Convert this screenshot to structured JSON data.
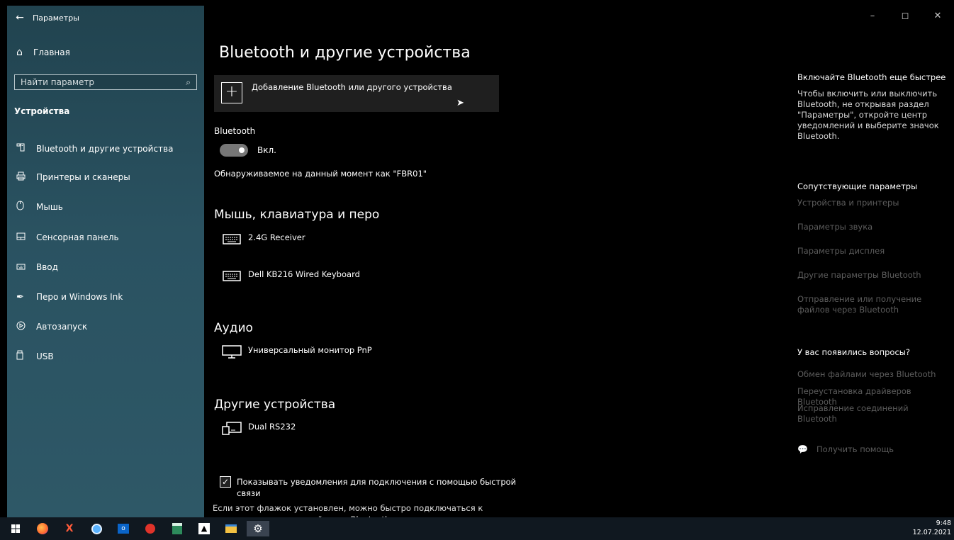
{
  "window": {
    "title": "Параметры",
    "back_icon": "←"
  },
  "controls": {
    "minimize": "–",
    "maximize": "◻",
    "close": "✕"
  },
  "sidebar": {
    "home_label": "Главная",
    "search_placeholder": "Найти параметр",
    "section": "Устройства",
    "items": [
      {
        "label": "Bluetooth и другие устройства",
        "icon": "bluetooth-devices-icon"
      },
      {
        "label": "Принтеры и сканеры",
        "icon": "printer-icon"
      },
      {
        "label": "Мышь",
        "icon": "mouse-icon"
      },
      {
        "label": "Сенсорная панель",
        "icon": "touchpad-icon"
      },
      {
        "label": "Ввод",
        "icon": "keyboard-icon"
      },
      {
        "label": "Перо и Windows Ink",
        "icon": "pen-icon"
      },
      {
        "label": "Автозапуск",
        "icon": "autoplay-icon"
      },
      {
        "label": "USB",
        "icon": "usb-icon"
      }
    ]
  },
  "main": {
    "title": "Bluetooth и другие устройства",
    "add_device": "Добавление Bluetooth или другого устройства",
    "bluetooth_label": "Bluetooth",
    "bluetooth_state": "Вкл.",
    "discoverable": "Обнаруживаемое на данный момент как \"FBR01\"",
    "mouse_section": "Мышь, клавиатура и перо",
    "mouse_devices": [
      "2.4G Receiver",
      "Dell KB216 Wired Keyboard"
    ],
    "audio_section": "Аудио",
    "audio_devices": [
      "Универсальный монитор PnP"
    ],
    "other_section": "Другие устройства",
    "other_devices": [
      "Dual RS232"
    ],
    "notify_checkbox": "Показывать уведомления для подключения с помощью быстрой связи",
    "notify_desc": "Если этот флажок установлен, можно быстро подключаться к поддерживаемым устройствам Bluetooth, когда они находятся"
  },
  "right": {
    "tip_title": "Включайте Bluetooth еще быстрее",
    "tip_text": "Чтобы включить или выключить Bluetooth, не открывая раздел \"Параметры\", откройте центр уведомлений и выберите значок Bluetooth.",
    "related_title": "Сопутствующие параметры",
    "related_links": [
      "Устройства и принтеры",
      "Параметры звука",
      "Параметры дисплея",
      "Другие параметры Bluetooth",
      "Отправление или получение файлов через Bluetooth"
    ],
    "questions_title": "У вас появились вопросы?",
    "question_links": [
      "Обмен файлами через Bluetooth",
      "Переустановка драйверов Bluetooth",
      "Исправление соединений Bluetooth"
    ],
    "help": "Получить помощь"
  },
  "taskbar": {
    "time": "9:48",
    "date": "12.07.2021"
  }
}
